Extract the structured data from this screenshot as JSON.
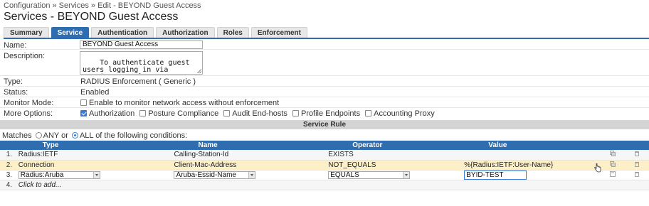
{
  "breadcrumb": "Configuration » Services » Edit - BEYOND Guest Access",
  "page_title": "Services - BEYOND Guest Access",
  "tabs": [
    "Summary",
    "Service",
    "Authentication",
    "Authorization",
    "Roles",
    "Enforcement"
  ],
  "active_tab": "Service",
  "form": {
    "name_label": "Name:",
    "name_value": "BEYOND Guest Access",
    "description_label": "Description:",
    "description_value": "To authenticate guest users logging in via captive portal. Guests must re-authenticate after their session ends.",
    "type_label": "Type:",
    "type_value": "RADIUS Enforcement ( Generic )",
    "status_label": "Status:",
    "status_value": "Enabled",
    "monitor_label": "Monitor Mode:",
    "monitor_option": "Enable to monitor network access without enforcement",
    "more_label": "More Options:",
    "more_options": [
      {
        "label": "Authorization",
        "checked": true
      },
      {
        "label": "Posture Compliance",
        "checked": false
      },
      {
        "label": "Audit End-hosts",
        "checked": false
      },
      {
        "label": "Profile Endpoints",
        "checked": false
      },
      {
        "label": "Accounting Proxy",
        "checked": false
      }
    ]
  },
  "service_rule": {
    "header": "Service Rule",
    "matches_prefix": "Matches",
    "any_label": "ANY or",
    "all_label": "ALL of the following conditions:",
    "selected": "ALL",
    "columns": [
      "Type",
      "Name",
      "Operator",
      "Value"
    ],
    "rows": [
      {
        "num": "1.",
        "type": "Radius:IETF",
        "name": "Calling-Station-Id",
        "operator": "EXISTS",
        "value": ""
      },
      {
        "num": "2.",
        "type": "Connection",
        "name": "Client-Mac-Address",
        "operator": "NOT_EQUALS",
        "value": "%{Radius:IETF:User-Name}"
      },
      {
        "num": "3.",
        "type": "Radius:Aruba",
        "name": "Aruba-Essid-Name",
        "operator": "EQUALS",
        "value": "BYID-TEST"
      },
      {
        "num": "4.",
        "placeholder": "Click to add..."
      }
    ]
  }
}
